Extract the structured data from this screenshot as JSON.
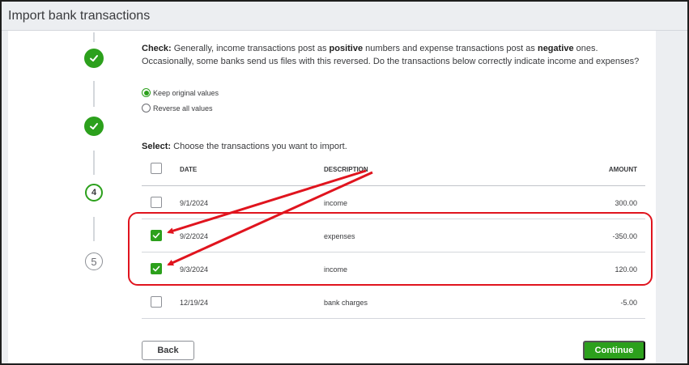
{
  "header": {
    "title": "Import bank transactions"
  },
  "steps": [
    {
      "state": "done",
      "icon": "check-icon"
    },
    {
      "state": "done",
      "icon": "check-icon"
    },
    {
      "state": "active",
      "label": "4"
    },
    {
      "state": "todo",
      "label": "5"
    }
  ],
  "check": {
    "lead": "Check:",
    "part1": " Generally, income transactions post as ",
    "positive": "positive",
    "part2": " numbers and expense transactions post as ",
    "negative": "negative",
    "part3": " ones. Occasionally, some banks send us files with this reversed. Do the transactions below correctly indicate income and expenses?"
  },
  "radios": [
    {
      "label": "Keep original values",
      "selected": true
    },
    {
      "label": "Reverse all values",
      "selected": false
    }
  ],
  "select": {
    "lead": "Select:",
    "text": " Choose the transactions you want to import."
  },
  "table": {
    "headers": {
      "date": "DATE",
      "description": "DESCRIPTION",
      "amount": "AMOUNT"
    },
    "rows": [
      {
        "date": "9/1/2024",
        "description": "income",
        "amount": "300.00",
        "checked": false
      },
      {
        "date": "9/2/2024",
        "description": "expenses",
        "amount": "-350.00",
        "checked": true
      },
      {
        "date": "9/3/2024",
        "description": "income",
        "amount": "120.00",
        "checked": true
      },
      {
        "date": "12/19/24",
        "description": "bank charges",
        "amount": "-5.00",
        "checked": false
      }
    ]
  },
  "buttons": {
    "back": "Back",
    "continue": "Continue"
  },
  "colors": {
    "accent": "#2ca01c",
    "annotation": "#e0141e",
    "header_bg": "#eceef1"
  }
}
